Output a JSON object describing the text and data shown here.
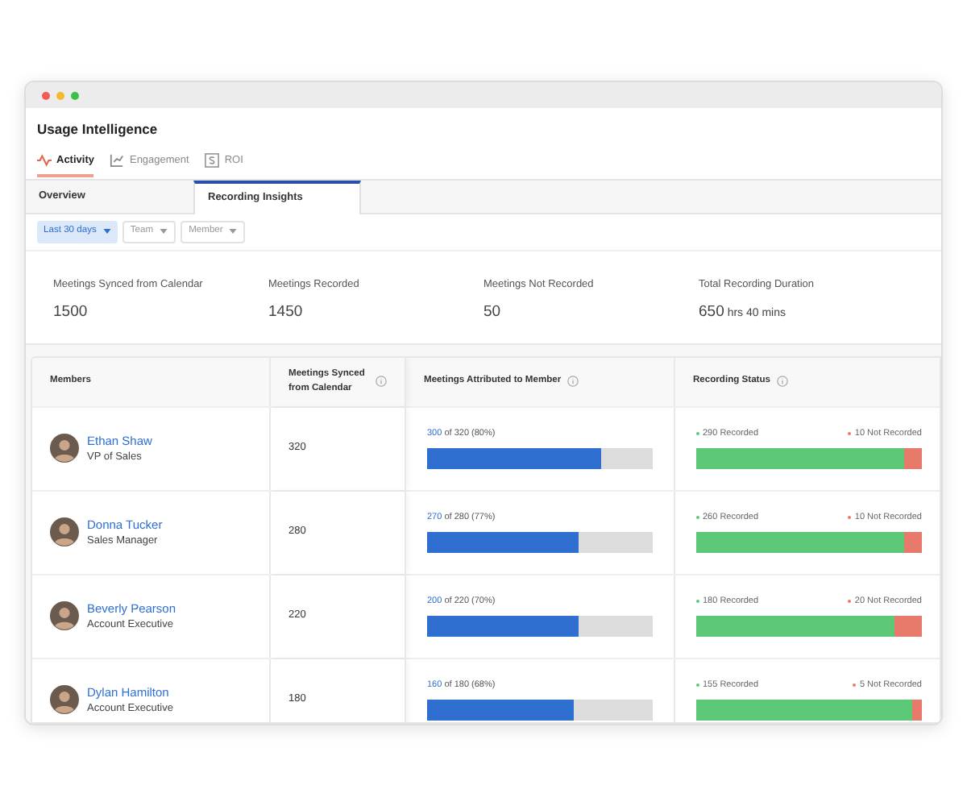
{
  "app_title": "Usage Intelligence",
  "nav_tabs": [
    {
      "label": "Activity",
      "kind": "activity",
      "selected": true
    },
    {
      "label": "Engagement",
      "kind": "engagement",
      "selected": false
    },
    {
      "label": "ROI",
      "kind": "roi",
      "selected": false
    }
  ],
  "sub_tabs": [
    {
      "label": "Overview",
      "selected": false
    },
    {
      "label": "Recording Insights",
      "selected": true
    }
  ],
  "filters": [
    {
      "label": "Last 30 days",
      "selected": true
    },
    {
      "label": "Team",
      "selected": false
    },
    {
      "label": "Member",
      "selected": false
    }
  ],
  "stats": [
    {
      "label": "Meetings Synced from Calendar",
      "value": "1500"
    },
    {
      "label": "Meetings Recorded",
      "value": "1450"
    },
    {
      "label": "Meetings Not Recorded",
      "value": "50"
    },
    {
      "label": "Total Recording Duration",
      "value": "650",
      "unit": "hrs 40 mins"
    }
  ],
  "table": {
    "columns": [
      {
        "label": "Members",
        "info": false
      },
      {
        "label": "Meetings Synced from Calendar",
        "info": true
      },
      {
        "label": "Meetings Attributed to Member",
        "info": true
      },
      {
        "label": "Recording Status",
        "info": true
      }
    ],
    "rows": [
      {
        "name": "Ethan Shaw",
        "role": "VP of Sales",
        "synced": "320",
        "attributed_count": "300",
        "attributed_rest": "of 320 (80%)",
        "level": 0.77,
        "recorded": "290 Recorded",
        "not_recorded": "10 Not Recorded",
        "status_bar": {
          "level": 0.92
        }
      },
      {
        "name": "Donna Tucker",
        "role": "Sales Manager",
        "synced": "280",
        "attributed_count": "270",
        "attributed_rest": "of 280 (77%)",
        "level": 0.67,
        "recorded": "260 Recorded",
        "not_recorded": "10 Not Recorded",
        "status_bar": {
          "level": 0.92
        }
      },
      {
        "name": "Beverly Pearson",
        "role": "Account Executive",
        "synced": "220",
        "attributed_count": "200",
        "attributed_rest": "of 220 (70%)",
        "level": 0.67,
        "recorded": "180 Recorded",
        "not_recorded": "20 Not Recorded",
        "status_bar": {
          "level": 0.875
        }
      },
      {
        "name": "Dylan Hamilton",
        "role": "Account Executive",
        "synced": "180",
        "attributed_count": "160",
        "attributed_rest": "of 180 (68%)",
        "level": 0.65,
        "recorded": "155 Recorded",
        "not_recorded": "5 Not Recorded",
        "status_bar": {
          "level": 0.955
        }
      }
    ]
  }
}
